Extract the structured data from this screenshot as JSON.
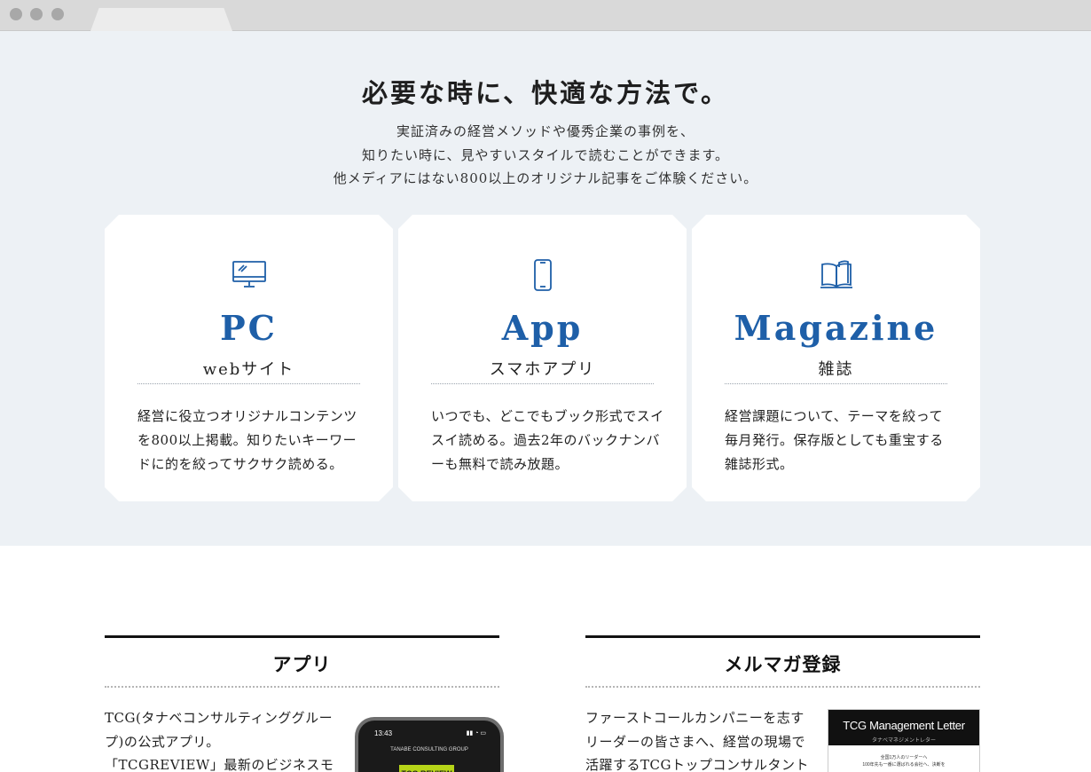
{
  "hero": {
    "title": "必要な時に、快適な方法で。",
    "desc": [
      "実証済みの経営メソッドや優秀企業の事例を、",
      "知りたい時に、見やすいスタイルで読むことができます。",
      "他メディアにはない800以上のオリジナル記事をご体験ください。"
    ]
  },
  "cards": [
    {
      "icon": "monitor-icon",
      "title": "PC",
      "subtitle": "webサイト",
      "text": [
        "経営に役立つオリジナルコンテンツ",
        "を800以上掲載。知りたいキーワー",
        "ドに的を絞ってサクサク読める。"
      ]
    },
    {
      "icon": "smartphone-icon",
      "title": "App",
      "subtitle": "スマホアプリ",
      "text": [
        "いつでも、どこでもブック形式でスイ",
        "スイ読める。過去2年のバックナンバ",
        "ーも無料で読み放題。"
      ]
    },
    {
      "icon": "book-icon",
      "title": "Magazine",
      "subtitle": "雑誌",
      "text": [
        "経営課題について、テーマを絞って",
        "毎月発行。保存版としても重宝する",
        "雑誌形式。"
      ]
    }
  ],
  "app_section": {
    "heading": "アプリ",
    "text": [
      "TCG(タナベコンサルティンググルー",
      "プ)の公式アプリ。",
      "「TCGREVIEW」最新のビジネスモ"
    ],
    "phone": {
      "time": "13:43",
      "brand": "TANABE CONSULTING GROUP",
      "logo": "TCG REVIEW"
    }
  },
  "mail_section": {
    "heading": "メルマガ登録",
    "text": [
      "ファーストコールカンパニーを志す",
      "リーダーの皆さまへ、経営の現場で",
      "活躍するTCGトップコンサルタント"
    ],
    "letter": {
      "title": "TCG Management Letter",
      "kana": "タナベマネジメントレター",
      "line1": "全国1万人のリーダーへ",
      "line2": "100年先も一番に選ばれる会社へ、決断を"
    }
  },
  "colors": {
    "accent": "#1e5fa8",
    "hero_bg": "#edf1f5",
    "logo_green": "#b6d418"
  }
}
